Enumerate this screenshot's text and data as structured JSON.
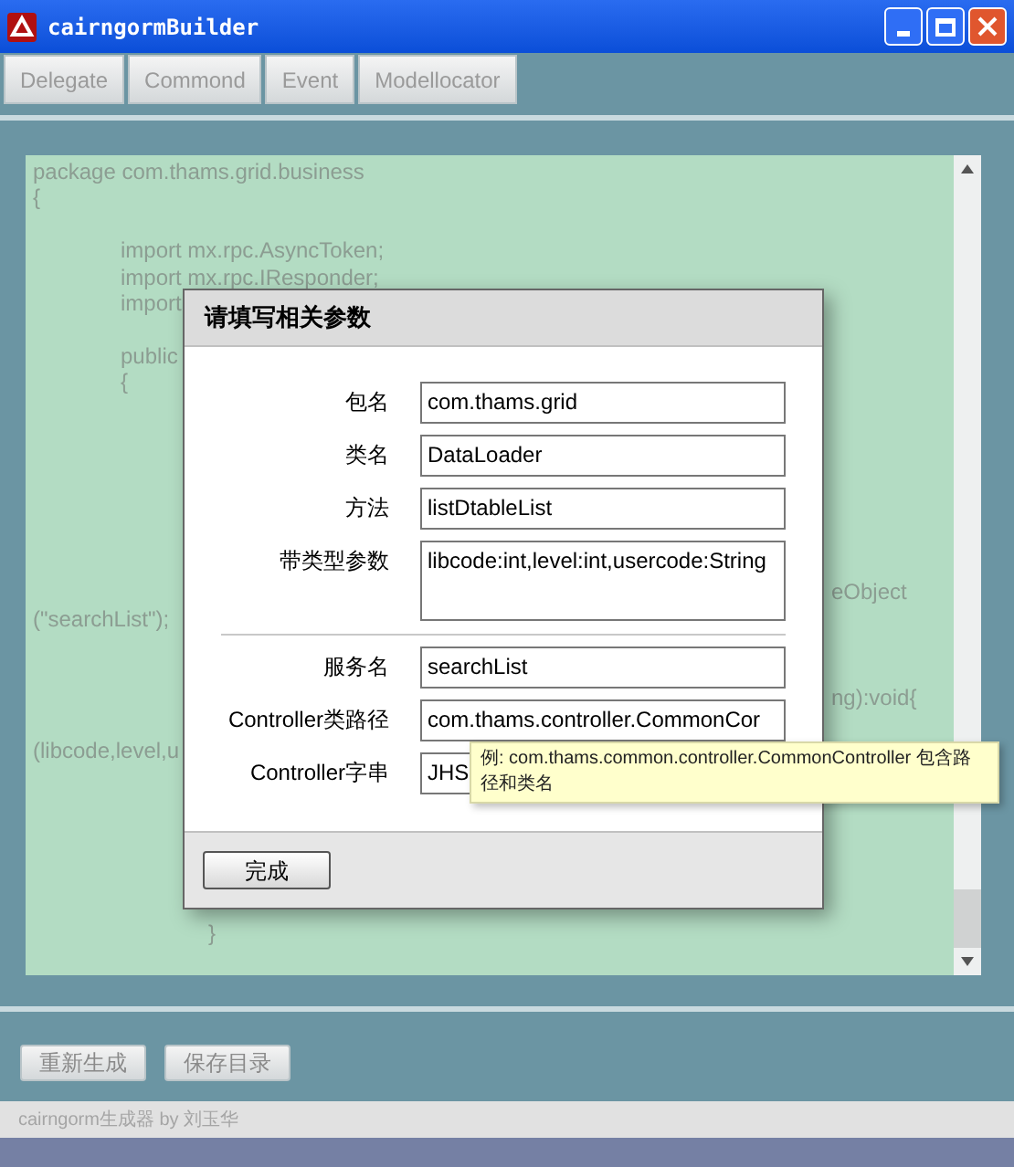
{
  "window": {
    "title": "cairngormBuilder"
  },
  "tabs": [
    {
      "label": "Delegate"
    },
    {
      "label": "Commond"
    },
    {
      "label": "Event"
    },
    {
      "label": "Modellocator"
    }
  ],
  "code_lines": [
    {
      "kind": "left",
      "text": "package com.thams.grid.business"
    },
    {
      "kind": "left",
      "text": "{"
    },
    {
      "kind": "left",
      "text": "\n\timport mx.rpc.AsyncToken;"
    },
    {
      "kind": "left",
      "text": "\timport mx.rpc.IResponder;"
    },
    {
      "kind": "left",
      "text": "\timport"
    },
    {
      "kind": "left",
      "text": "\n\tpublic"
    },
    {
      "kind": "left",
      "text": "\t{"
    },
    {
      "kind": "right",
      "text": "\n\n\n\n\n\n\neObject"
    },
    {
      "kind": "left",
      "text": "(\"searchList\");"
    },
    {
      "kind": "right",
      "text": "\n\nng):void{"
    },
    {
      "kind": "left",
      "text": "\n(libcode,level,u"
    },
    {
      "kind": "left",
      "text": "\n\n\n\n\n\n\t\t}"
    }
  ],
  "dialog": {
    "title": "请填写相关参数",
    "fields": [
      {
        "label": "包名",
        "value": "com.thams.grid",
        "kind": "input"
      },
      {
        "label": "类名",
        "value": "DataLoader",
        "kind": "input"
      },
      {
        "label": "方法",
        "value": "listDtableList",
        "kind": "input"
      },
      {
        "label": "带类型参数",
        "value": "libcode:int,level:int,usercode:String",
        "kind": "textarea"
      },
      {
        "kind": "divider"
      },
      {
        "label": "服务名",
        "value": "searchList",
        "kind": "input"
      },
      {
        "label": "Controller类路径",
        "value": "com.thams.controller.CommonCor",
        "kind": "input"
      },
      {
        "label": "Controller字串",
        "value": "JHS",
        "kind": "input"
      }
    ],
    "button": "完成"
  },
  "tooltip": "例: com.thams.common.controller.CommonController 包含路径和类名",
  "bottom_buttons": [
    "重新生成",
    "保存目录"
  ],
  "status_bar": "cairngorm生成器 by 刘玉华"
}
